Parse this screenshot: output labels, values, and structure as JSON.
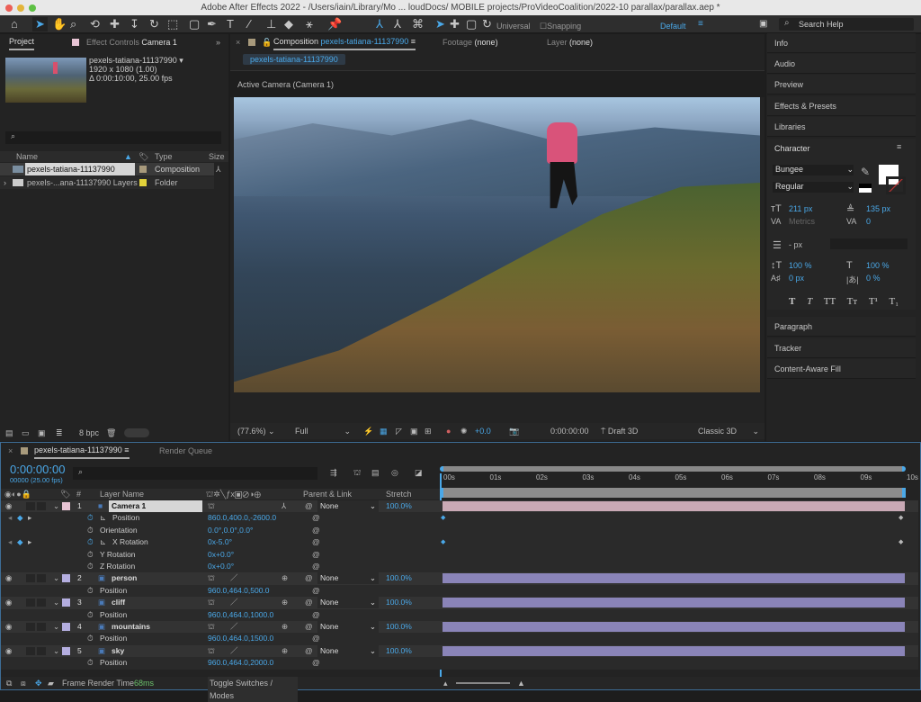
{
  "window": {
    "title": "Adobe After Effects 2022 - /Users/iain/Library/Mo ... loudDocs/ MOBILE projects/ProVideoCoalition/2022-10 parallax/parallax.aep *"
  },
  "toolbar": {
    "universal": "Universal",
    "snapping": "Snapping",
    "workspace": "Default",
    "search_placeholder": "Search Help"
  },
  "project": {
    "tab": "Project",
    "effect_controls_prefix": "Effect Controls",
    "effect_controls_target": "Camera 1",
    "comp_name": "pexels-tatiana-11137990 ▾",
    "comp_size": "1920 x 1080 (1.00)",
    "comp_duration": "Δ 0:00:10:00, 25.00 fps",
    "columns": {
      "name": "Name",
      "type": "Type",
      "size": "Size"
    },
    "items": [
      {
        "name": "pexels-tatiana-11137990",
        "type": "Composition",
        "color": "#a89a7c"
      },
      {
        "name": "pexels-...ana-11137990 Layers",
        "type": "Folder",
        "color": "#e2d23a"
      }
    ],
    "bpc": "8 bpc"
  },
  "composition": {
    "tab_label": "Composition",
    "tab_name": "pexels-tatiana-11137990",
    "footage": "Footage",
    "footage_val": "(none)",
    "layer": "Layer",
    "layer_val": "(none)",
    "sub_tab": "pexels-tatiana-11137990",
    "camera_label": "Active Camera (Camera 1)",
    "zoom": "(77.6%)",
    "resolution": "Full",
    "exposure": "+0.0",
    "timecode": "0:00:00:00",
    "draft": "Draft 3D",
    "renderer": "Classic 3D"
  },
  "right_panel": {
    "items": [
      "Info",
      "Audio",
      "Preview",
      "Effects & Presets",
      "Libraries"
    ],
    "character_title": "Character",
    "font": "Bungee",
    "style": "Regular",
    "font_size": "211 px",
    "leading": "135 px",
    "kerning": "Metrics",
    "tracking": "0",
    "stroke": "- px",
    "vscale": "100 %",
    "hscale": "100 %",
    "baseline": "0 px",
    "tsume": "0 %",
    "styles": [
      "T",
      "T",
      "TT",
      "Tт",
      "T¹",
      "T₁"
    ],
    "bottom_items": [
      "Paragraph",
      "Tracker",
      "Content-Aware Fill"
    ]
  },
  "timeline": {
    "tab": "pexels-tatiana-11137990",
    "render_queue": "Render Queue",
    "timecode": "0:00:00:00",
    "frames": "00000 (25.00 fps)",
    "columns": {
      "num": "#",
      "layer_name": "Layer Name",
      "parent": "Parent & Link",
      "stretch": "Stretch"
    },
    "ruler": [
      "00s",
      "01s",
      "02s",
      "03s",
      "04s",
      "05s",
      "06s",
      "07s",
      "08s",
      "09s",
      "10s"
    ],
    "rows": [
      {
        "kind": "layer",
        "num": "1",
        "name": "Camera 1",
        "parent": "None",
        "stretch": "100.0%",
        "color": "#e8c4d4",
        "bar": "#c9a9b5",
        "selected": true
      },
      {
        "kind": "prop",
        "name": "Position",
        "value": "860.0,400.0,-2600.0",
        "keyframe": true
      },
      {
        "kind": "prop",
        "name": "Orientation",
        "value": "0.0°,0.0°,0.0°"
      },
      {
        "kind": "prop",
        "name": "X Rotation",
        "value": "0x-5.0°",
        "keyframe": true
      },
      {
        "kind": "prop",
        "name": "Y Rotation",
        "value": "0x+0.0°"
      },
      {
        "kind": "prop",
        "name": "Z Rotation",
        "value": "0x+0.0°"
      },
      {
        "kind": "layer",
        "num": "2",
        "name": "person",
        "parent": "None",
        "stretch": "100.0%",
        "color": "#b4aee0",
        "bar": "#8a84b8"
      },
      {
        "kind": "prop",
        "name": "Position",
        "value": "960.0,464.0,500.0"
      },
      {
        "kind": "layer",
        "num": "3",
        "name": "cliff",
        "parent": "None",
        "stretch": "100.0%",
        "color": "#b4aee0",
        "bar": "#8a84b8"
      },
      {
        "kind": "prop",
        "name": "Position",
        "value": "960.0,464.0,1000.0"
      },
      {
        "kind": "layer",
        "num": "4",
        "name": "mountains",
        "parent": "None",
        "stretch": "100.0%",
        "color": "#b4aee0",
        "bar": "#8a84b8"
      },
      {
        "kind": "prop",
        "name": "Position",
        "value": "960.0,464.0,1500.0"
      },
      {
        "kind": "layer",
        "num": "5",
        "name": "sky",
        "parent": "None",
        "stretch": "100.0%",
        "color": "#b4aee0",
        "bar": "#8a84b8"
      },
      {
        "kind": "prop",
        "name": "Position",
        "value": "960.0,464.0,2000.0"
      }
    ],
    "frame_render_label": "Frame Render Time",
    "frame_render_value": "68ms",
    "toggle": "Toggle Switches / Modes"
  }
}
